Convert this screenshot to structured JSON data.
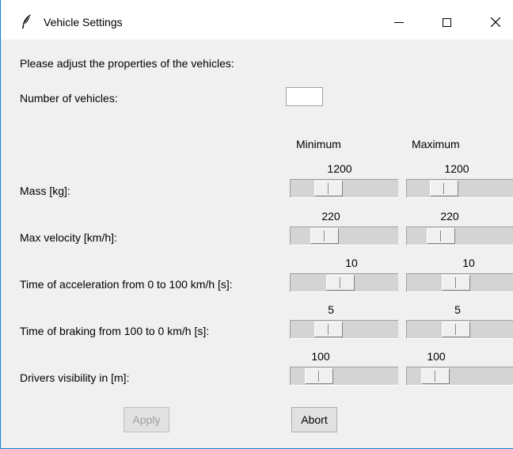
{
  "window": {
    "title": "Vehicle Settings",
    "title_icon": "feather-icon"
  },
  "window_controls": {
    "minimize": "minimize-icon",
    "maximize": "maximize-icon",
    "close": "close-icon"
  },
  "intro": "Please adjust the properties of the vehicles:",
  "vehicle_count": {
    "label": "Number of vehicles:",
    "value": ""
  },
  "headers": {
    "min": "Minimum",
    "max": "Maximum"
  },
  "rows": [
    {
      "label": "Mass [kg]:",
      "min": "1200",
      "max": "1200",
      "min_fraction": 0.3,
      "max_fraction": 0.3
    },
    {
      "label": "Max velocity [km/h]:",
      "min": "220",
      "max": "220",
      "min_fraction": 0.25,
      "max_fraction": 0.25
    },
    {
      "label": "Time of acceleration from 0 to 100 km/h [s]:",
      "min": "10",
      "max": "10",
      "min_fraction": 0.45,
      "max_fraction": 0.45
    },
    {
      "label": "Time of braking from 100 to 0 km/h [s]:",
      "min": "5",
      "max": "5",
      "min_fraction": 0.3,
      "max_fraction": 0.45
    },
    {
      "label": "Drivers visibility in [m]:",
      "min": "100",
      "max": "100",
      "min_fraction": 0.18,
      "max_fraction": 0.18
    }
  ],
  "buttons": {
    "apply": "Apply",
    "abort": "Abort"
  }
}
